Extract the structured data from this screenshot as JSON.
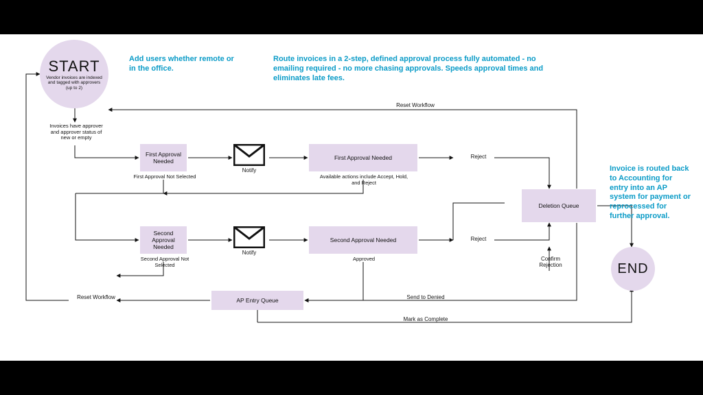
{
  "start": {
    "title": "START",
    "sub": "Vendor invoices are indexed and tagged with approvers (up to 2)"
  },
  "end": {
    "title": "END"
  },
  "annotations": {
    "addUsers": "Add users whether remote or in the office.",
    "route": "Route invoices in a 2-step, defined approval process fully automated - no emailing required - no more chasing approvals. Speeds approval times and eliminates late fees.",
    "routed": "Invoice is routed back to Accounting for entry into an AP system for payment or reprocessed for further approval."
  },
  "boxes": {
    "firstApproval": "First Approval Needed",
    "firstApprovalWide": "First Approval Needed",
    "secondApproval": "Second Approval Needed",
    "secondApprovalWide": "Second Approval Needed",
    "deletionQueue": "Deletion Queue",
    "apEntryQueue": "AP Entry Queue"
  },
  "captions": {
    "underFirst": "First Approval Not Selected",
    "underFirstWide": "Available actions include Accept, Hold, and Reject",
    "underSecond": "Second Approval Not Selected",
    "underSecondWide": "Approved",
    "invoicesHave": "Invoices have approver and approver status of new or empty"
  },
  "labels": {
    "notify": "Notify",
    "reject1": "Reject",
    "reject2": "Reject",
    "confirmRejection": "Confirm Rejection",
    "sendToDenied": "Send to Denied",
    "markComplete": "Mark as Complete",
    "resetWorkflowTop": "Reset Workflow",
    "resetWorkflowLeft": "Reset Workflow"
  }
}
